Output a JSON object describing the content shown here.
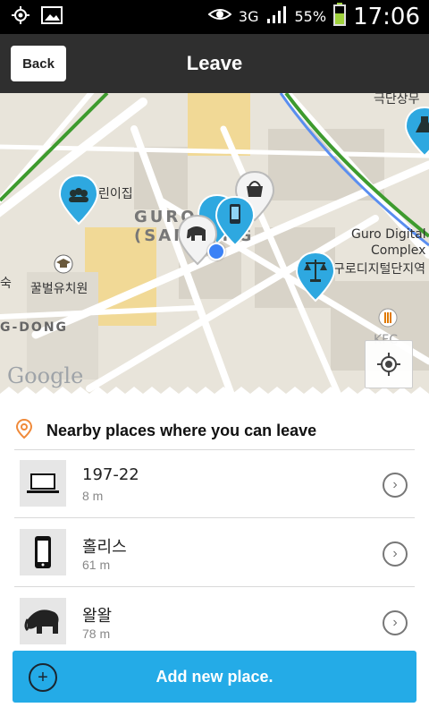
{
  "status": {
    "network": "3G",
    "battery": "55%",
    "time": "17:06"
  },
  "header": {
    "back_label": "Back",
    "title": "Leave"
  },
  "map": {
    "labels": {
      "top_right": "극단상무",
      "left_top": "린이집",
      "center_big": "GURO\n(SAMSUNG",
      "guro_digital": "Guro Digital",
      "complex": "Complex",
      "korean_complex": "구로디지털단지역",
      "kindergarten": "꿀벌유치원",
      "left_small": "숙",
      "dong": "G-DONG",
      "kfc": "KFC"
    },
    "watermark": "Google"
  },
  "nearby": {
    "title": "Nearby places where you can leave",
    "places": [
      {
        "name": "197-22",
        "distance": "8 m",
        "icon": "laptop-icon"
      },
      {
        "name": "홀리스",
        "distance": "61 m",
        "icon": "phone-icon"
      },
      {
        "name": "왈왈",
        "distance": "78 m",
        "icon": "elephant-icon"
      }
    ]
  },
  "add_place": {
    "label": "Add new place."
  },
  "colors": {
    "accent_blue": "#24abe7",
    "header_dark": "#2f2f2f"
  }
}
